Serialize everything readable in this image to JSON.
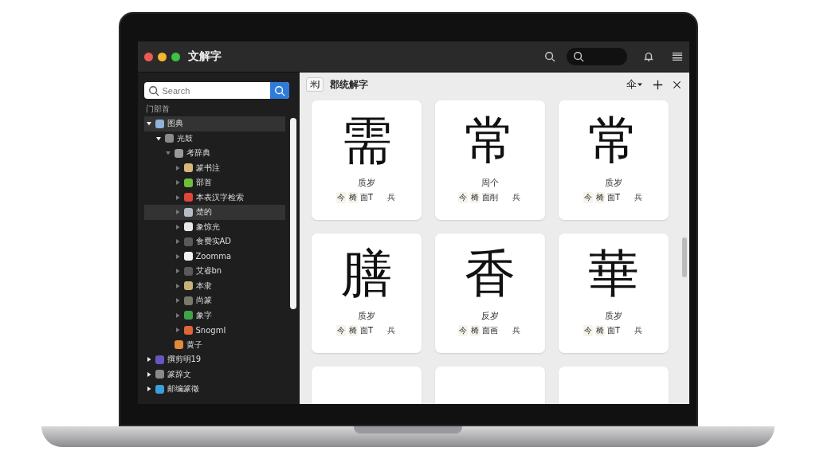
{
  "window": {
    "title": "文解字"
  },
  "sidebar": {
    "search": {
      "placeholder": "Search"
    },
    "heading": "门部首",
    "tree": [
      {
        "label": "图典",
        "selected": true,
        "expanded": true,
        "color": "#8fb3d9",
        "children": [
          {
            "label": "光鼓",
            "selected": false,
            "expanded": true,
            "color": "#8a8a8a",
            "children": [
              {
                "label": "考辞典",
                "selected": false,
                "expanded": true,
                "color": "#9a9a9a",
                "children": [
                  {
                    "label": "篆书注",
                    "selected": false,
                    "expanded": false,
                    "color": "#d9b77a"
                  },
                  {
                    "label": "部首",
                    "selected": false,
                    "expanded": false,
                    "color": "#6fbf3a"
                  },
                  {
                    "label": "本表汉字检索",
                    "selected": false,
                    "expanded": false,
                    "color": "#e0453a"
                  },
                  {
                    "label": "楚的",
                    "selected": true,
                    "expanded": false,
                    "color": "#b8bcc8"
                  },
                  {
                    "label": "象惊光",
                    "selected": false,
                    "expanded": false,
                    "color": "#e8e8e8"
                  },
                  {
                    "label": "食费实AD",
                    "selected": false,
                    "expanded": false,
                    "color": "#5a5a5a"
                  },
                  {
                    "label": "Zoomma",
                    "selected": false,
                    "expanded": false,
                    "color": "#f2f2f2"
                  },
                  {
                    "label": "艾睿bn",
                    "selected": false,
                    "expanded": false,
                    "color": "#5a5a5a"
                  },
                  {
                    "label": "本隶",
                    "selected": false,
                    "expanded": false,
                    "color": "#c9b27a"
                  },
                  {
                    "label": "尚篆",
                    "selected": false,
                    "expanded": false,
                    "color": "#7a7a6a"
                  },
                  {
                    "label": "象字",
                    "selected": false,
                    "expanded": false,
                    "color": "#3fa34a"
                  },
                  {
                    "label": "Snogml",
                    "selected": false,
                    "expanded": false,
                    "color": "#e0643a"
                  }
                ]
              },
              {
                "label": "黄子",
                "selected": false,
                "color": "#e08a3a"
              }
            ]
          }
        ]
      },
      {
        "label": "撰剪明19",
        "selected": false,
        "expanded": false,
        "color": "#6a55c0"
      },
      {
        "label": "篆辞文",
        "selected": false,
        "expanded": false,
        "color": "#8a8a8a"
      },
      {
        "label": "邮编篆徵",
        "selected": false,
        "expanded": false,
        "color": "#3aa0d9"
      }
    ]
  },
  "content": {
    "tag": "米J",
    "title": "郡统解字",
    "menu": "伞",
    "cards": [
      {
        "glyph": "需",
        "caption": "质岁",
        "tags": [
          "今",
          "椅"
        ],
        "note": "面T",
        "mark": "兵"
      },
      {
        "glyph": "常",
        "caption": "周个",
        "tags": [
          "今",
          "椅"
        ],
        "note": "面削",
        "mark": "兵"
      },
      {
        "glyph": "常",
        "caption": "质岁",
        "tags": [
          "今",
          "椅"
        ],
        "note": "面T",
        "mark": "兵"
      },
      {
        "glyph": "膳",
        "caption": "质岁",
        "tags": [
          "今",
          "椅"
        ],
        "note": "面T",
        "mark": "兵"
      },
      {
        "glyph": "香",
        "caption": "反岁",
        "tags": [
          "今",
          "椅"
        ],
        "note": "面画",
        "mark": "兵"
      },
      {
        "glyph": "華",
        "caption": "质岁",
        "tags": [
          "今",
          "椅"
        ],
        "note": "面T",
        "mark": "兵"
      },
      {
        "kind": "partial"
      },
      {
        "kind": "partial"
      },
      {
        "kind": "partial"
      }
    ]
  }
}
